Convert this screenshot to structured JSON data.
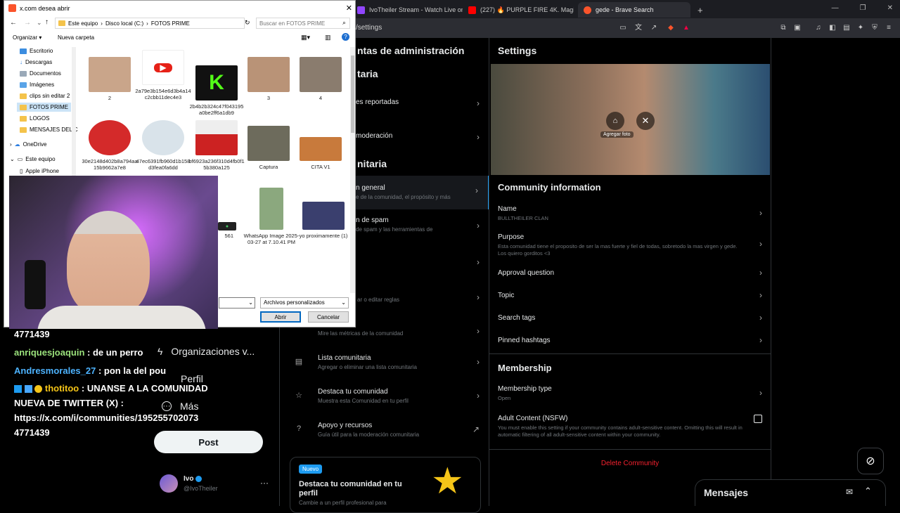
{
  "browser": {
    "tabs": [
      {
        "label": "IvoTheiler Stream - Watch Live on"
      },
      {
        "label": "(227) 🔥 PURPLE FIRE 4K. Magic Fire"
      },
      {
        "label": "gede - Brave Search"
      }
    ],
    "url": "/settings"
  },
  "mid": {
    "header": "ntas de administración",
    "section1": "taria",
    "item_reported": "es reportadas",
    "item_moderation": "moderación",
    "section2": "nitaria",
    "item_general_title": "n general",
    "item_general_sub": "e de la comunidad, el propósito y más",
    "item_spam_title": "n de spam",
    "item_spam_sub": "de spam y las herramientas de",
    "item_rules_sub": "ar o editar reglas",
    "item_metrics_sub": "Mire las métricas de la comunidad",
    "list_title": "Lista comunitaria",
    "list_sub": "Agregar o eliminar una lista comunitaria",
    "feature_title": "Destaca tu comunidad",
    "feature_sub": "Muestra esta Comunidad en tu perfil",
    "support_title": "Apoyo y recursos",
    "support_sub": "Guía útil para la moderación comunitaria",
    "promo_badge": "Nuevo",
    "promo_title": "Destaca tu comunidad en tu perfil",
    "promo_sub": "Cambie a un perfil profesional para"
  },
  "settings": {
    "title": "Settings",
    "add_photo": "Agregar foto",
    "info_header": "Community information",
    "name_label": "Name",
    "name_value": "BULLTHEILER CLAN",
    "purpose_label": "Purpose",
    "purpose_value": "Esta comunidad tiene el proposito de ser la mas fuerte y fiel de todas, sobretodo la mas virgen y gede. Los quiero gorditos <3",
    "approval_label": "Approval question",
    "topic_label": "Topic",
    "search_tags_label": "Search tags",
    "pinned_label": "Pinned hashtags",
    "membership_header": "Membership",
    "membership_type_label": "Membership type",
    "membership_type_value": "Open",
    "adult_label": "Adult Content (NSFW)",
    "adult_desc": "You must enable this setting if your community contains adult-sensitive content. Omitting this will result in automatic filtering of all adult-sensitive content within your community.",
    "delete_label": "Delete Community"
  },
  "messages": {
    "label": "Mensajes"
  },
  "chat": {
    "line0": "4771439",
    "m1_user": "anriquesjoaquin",
    "m1_text": ": de un perro",
    "m2_user": "Andresmorales_27",
    "m2_text": ": pon la del pou",
    "m3_user": "thotitoo",
    "m3_text": ": UNANSE A LA COMUNIDAD",
    "m3_line2": "NUEVA DE TWITTER (X) :",
    "m3_line3": "https://x.com/i/communities/195255702073",
    "m3_line4": "4771439"
  },
  "nav": {
    "orgs": "Organizaciones v...",
    "profile": "Perfil",
    "more": "Más",
    "post": "Post",
    "user_name": "Ivo",
    "user_handle": "@IvoTheiler"
  },
  "dialog": {
    "title": "x.com desea abrir",
    "path": [
      "Este equipo",
      "Disco local (C:)",
      "FOTOS PRIME"
    ],
    "search_placeholder": "Buscar en FOTOS PRIME",
    "organize": "Organizar",
    "new_folder": "Nueva carpeta",
    "tree": [
      "Escritorio",
      "Descargas",
      "Documentos",
      "Imágenes",
      "clips sin editar 2",
      "FOTOS PRIME",
      "LOGOS",
      "MENSAJES DEL C",
      "OneDrive",
      "Este equipo",
      "Apple iPhone"
    ],
    "files": [
      {
        "name": "2",
        "color": "#c9a58a"
      },
      {
        "name": "2a79e3b154e6d3b4a14c2cbb11dec4e3",
        "color": "#e62117"
      },
      {
        "name": "2b4b2b324c47f043195a0be2ff6a1db9",
        "color": "#53fc18"
      },
      {
        "name": "3",
        "color": "#b99377"
      },
      {
        "name": "4",
        "color": "#8a7c6e"
      },
      {
        "name": "30e2148d402b8a794aa15b9662a7e8",
        "color": "#d42a2a"
      },
      {
        "name": "47ec6391fb960d1b158d3fea0fa6dd",
        "color": "#d9e3ea"
      },
      {
        "name": "bf6923a236f310d4fb0f15b380a125",
        "color": "#c22"
      },
      {
        "name": "Captura",
        "color": "#6d6b5c"
      },
      {
        "name": "CITA V1",
        "color": "#c87a3c"
      },
      {
        "name": "561",
        "color": "#444"
      },
      {
        "name": "WhatsApp Image 2025-03-27 at 7.10.41 PM",
        "color": "#8ba87e"
      },
      {
        "name": "yo proximamente (1)",
        "color": "#3a3f6e"
      }
    ],
    "filetype": "Archivos personalizados",
    "open": "Abrir",
    "cancel": "Cancelar"
  }
}
